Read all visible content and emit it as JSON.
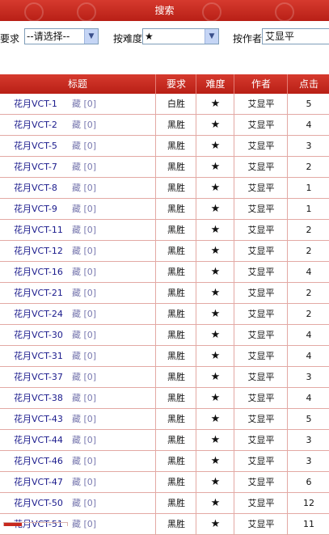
{
  "search": {
    "title": "搜索",
    "req_label": "按要求",
    "req_value": "--请选择--",
    "diff_label": "按难度",
    "diff_value": "★",
    "author_label": "按作者",
    "author_value": "艾显平"
  },
  "table": {
    "headers": [
      "标题",
      "要求",
      "难度",
      "作者",
      "点击"
    ],
    "fav_label": "藏 [0]",
    "rows": [
      {
        "title": "花月VCT-1",
        "req": "白胜",
        "diff": "★",
        "author": "艾显平",
        "clicks": "5"
      },
      {
        "title": "花月VCT-2",
        "req": "黑胜",
        "diff": "★",
        "author": "艾显平",
        "clicks": "4"
      },
      {
        "title": "花月VCT-5",
        "req": "黑胜",
        "diff": "★",
        "author": "艾显平",
        "clicks": "3"
      },
      {
        "title": "花月VCT-7",
        "req": "黑胜",
        "diff": "★",
        "author": "艾显平",
        "clicks": "2"
      },
      {
        "title": "花月VCT-8",
        "req": "黑胜",
        "diff": "★",
        "author": "艾显平",
        "clicks": "1"
      },
      {
        "title": "花月VCT-9",
        "req": "黑胜",
        "diff": "★",
        "author": "艾显平",
        "clicks": "1"
      },
      {
        "title": "花月VCT-11",
        "req": "黑胜",
        "diff": "★",
        "author": "艾显平",
        "clicks": "2"
      },
      {
        "title": "花月VCT-12",
        "req": "黑胜",
        "diff": "★",
        "author": "艾显平",
        "clicks": "2"
      },
      {
        "title": "花月VCT-16",
        "req": "黑胜",
        "diff": "★",
        "author": "艾显平",
        "clicks": "4"
      },
      {
        "title": "花月VCT-21",
        "req": "黑胜",
        "diff": "★",
        "author": "艾显平",
        "clicks": "2"
      },
      {
        "title": "花月VCT-24",
        "req": "黑胜",
        "diff": "★",
        "author": "艾显平",
        "clicks": "2"
      },
      {
        "title": "花月VCT-30",
        "req": "黑胜",
        "diff": "★",
        "author": "艾显平",
        "clicks": "4"
      },
      {
        "title": "花月VCT-31",
        "req": "黑胜",
        "diff": "★",
        "author": "艾显平",
        "clicks": "4"
      },
      {
        "title": "花月VCT-37",
        "req": "黑胜",
        "diff": "★",
        "author": "艾显平",
        "clicks": "3"
      },
      {
        "title": "花月VCT-38",
        "req": "黑胜",
        "diff": "★",
        "author": "艾显平",
        "clicks": "4"
      },
      {
        "title": "花月VCT-43",
        "req": "黑胜",
        "diff": "★",
        "author": "艾显平",
        "clicks": "5"
      },
      {
        "title": "花月VCT-44",
        "req": "黑胜",
        "diff": "★",
        "author": "艾显平",
        "clicks": "3"
      },
      {
        "title": "花月VCT-46",
        "req": "黑胜",
        "diff": "★",
        "author": "艾显平",
        "clicks": "3"
      },
      {
        "title": "花月VCT-47",
        "req": "黑胜",
        "diff": "★",
        "author": "艾显平",
        "clicks": "6"
      },
      {
        "title": "花月VCT-50",
        "req": "黑胜",
        "diff": "★",
        "author": "艾显平",
        "clicks": "12"
      },
      {
        "title": "花月VCT-51",
        "req": "黑胜",
        "diff": "★",
        "author": "艾显平",
        "clicks": "11"
      }
    ]
  },
  "colors": {
    "header_red": "#c8281e",
    "grid_line": "#e3a9a4",
    "link_blue": "#1a1a8c"
  },
  "icons": {
    "dropdown": "chevron-down-icon"
  }
}
